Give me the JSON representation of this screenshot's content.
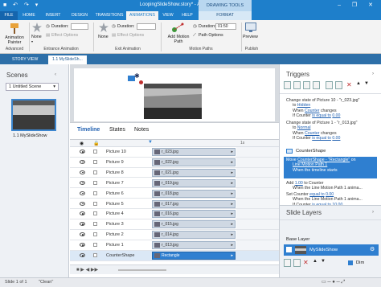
{
  "window": {
    "title": "LoopingSlideShow.story* - Articulate Storyline 2",
    "contextual_tab": "DRAWING TOOLS",
    "controls": "– ❐ ✕"
  },
  "tabs": [
    "FILE",
    "HOME",
    "INSERT",
    "DESIGN",
    "TRANSITIONS",
    "ANIMATIONS",
    "VIEW",
    "HELP",
    "FORMAT"
  ],
  "ribbon": {
    "animation_painter": "Animation Painter",
    "entrance_none": "None",
    "duration_label": "Duration:",
    "entrance_duration": "",
    "effect_options": "Effect Options",
    "entrance_group": "Entrance Animation",
    "exit_none": "None",
    "exit_duration": "",
    "exit_effect_options": "Effect Options",
    "exit_group": "Exit Animation",
    "add_motion_path": "Add Motion Path",
    "path_options": "Path Options",
    "motion_duration": "01:50",
    "motion_group": "Motion Paths",
    "preview": "Preview",
    "advanced_group": "Advanced",
    "publish_group": "Publish"
  },
  "story_tabs": [
    "STORY VIEW",
    "1.1 MySlideSh..."
  ],
  "scenes": {
    "title": "Scenes",
    "dropdown": "1 Untitled Scene",
    "slide_label": "1.1 MySlideShow"
  },
  "timeline": {
    "tabs": [
      "Timeline",
      "States",
      "Notes"
    ],
    "ruler_end": "1s",
    "rows": [
      {
        "name": "Picture 10",
        "item": "r_023.jpg"
      },
      {
        "name": "Picture 9",
        "item": "r_022.jpg"
      },
      {
        "name": "Picture 8",
        "item": "r_021.jpg"
      },
      {
        "name": "Picture 7",
        "item": "r_019.jpg"
      },
      {
        "name": "Picture 6",
        "item": "r_018.jpg"
      },
      {
        "name": "Picture 5",
        "item": "r_017.jpg"
      },
      {
        "name": "Picture 4",
        "item": "r_016.jpg"
      },
      {
        "name": "Picture 3",
        "item": "r_015.jpg"
      },
      {
        "name": "Picture 2",
        "item": "r_014.jpg"
      },
      {
        "name": "Picture 1",
        "item": "r_013.jpg"
      },
      {
        "name": "CounterShape",
        "item": "Rectangle"
      }
    ]
  },
  "triggers": {
    "title": "Triggers",
    "t1a": "Change state of Picture 10 - \"r_023.jpg\"",
    "t1b": "to",
    "t1c": "Hidden",
    "t1d": "When",
    "t1e": "Counter",
    "t1f": "changes",
    "t1g": "If Counter",
    "t1h": "is equal to",
    "t1i": "0.00",
    "t2a": "Change state of Picture 1 - \"r_013.jpg\"",
    "t2b": "to",
    "t2c": "Normal",
    "t2d": "When",
    "t2e": "Counter",
    "t2f": "changes",
    "t2g": "If Counter",
    "t2h": "is equal to",
    "t2i": "0.00",
    "section": "CounterShape",
    "sel1": "Move",
    "sel2": "CounterShape - \"Rectangle\"",
    "sel3": "on",
    "sel4": "Line Motion Path 1",
    "sel5": "When the timeline starts",
    "t4a": "Add",
    "t4b": "1.00",
    "t4c": "to Counter",
    "t4d": "When the Line Motion Path 1 anima...",
    "t5a": "Set Counter",
    "t5b": "equal to",
    "t5c": "0.00",
    "t5d": "When the Line Motion Path 1 anima...",
    "t5e": "If Counter",
    "t5f": "is equal to",
    "t5g": "10.00"
  },
  "layers": {
    "title": "Slide Layers",
    "base": "Base Layer",
    "base_name": "MySlideShow",
    "dim": "Dim"
  },
  "status": {
    "slide": "Slide 1 of 1",
    "theme": "\"Clean\""
  },
  "colors": {
    "accent": "#1e7fcb",
    "selection": "#2f7fd0"
  }
}
